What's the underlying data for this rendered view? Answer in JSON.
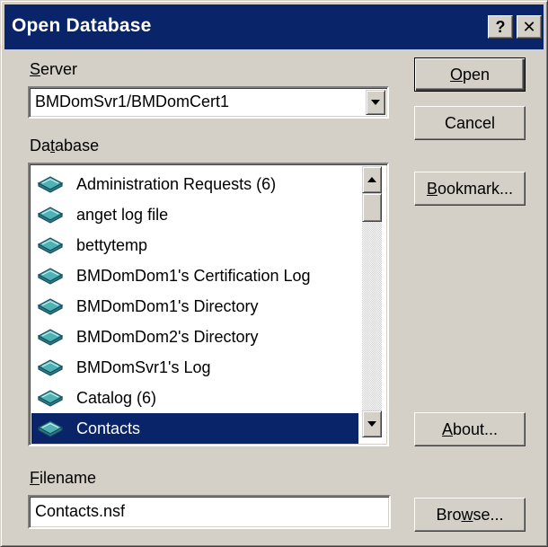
{
  "dialog": {
    "title": "Open Database",
    "help_label": "?",
    "close_label": "✕"
  },
  "server": {
    "label_mnemonic": "S",
    "label_rest": "erver",
    "value": "BMDomSvr1/BMDomCert1"
  },
  "database": {
    "label_before": "Da",
    "label_mnemonic": "t",
    "label_after": "abase",
    "items": [
      {
        "label": "Administration Requests (6)"
      },
      {
        "label": "anget log file"
      },
      {
        "label": "bettytemp"
      },
      {
        "label": "BMDomDom1's Certification Log"
      },
      {
        "label": "BMDomDom1's Directory"
      },
      {
        "label": "BMDomDom2's Directory"
      },
      {
        "label": "BMDomSvr1's Log"
      },
      {
        "label": "Catalog (6)"
      },
      {
        "label": "Contacts"
      }
    ],
    "selected_index": 8
  },
  "filename": {
    "label_mnemonic": "F",
    "label_rest": "ilename",
    "value": "Contacts.nsf"
  },
  "buttons": {
    "open_mnemonic": "O",
    "open_rest": "pen",
    "cancel": "Cancel",
    "bookmark_mnemonic": "B",
    "bookmark_rest": "ookmark...",
    "about_mnemonic": "A",
    "about_rest": "bout...",
    "browse_before": "Bro",
    "browse_mnemonic": "w",
    "browse_after": "se..."
  },
  "icons": {
    "list_item_icon": "book-icon",
    "dropdown_icon": "chevron-down-icon"
  },
  "colors": {
    "titlebar": "#0a246a",
    "selection": "#0a246a",
    "face": "#d4d0c8",
    "book_icon": "#4fb3b5"
  }
}
